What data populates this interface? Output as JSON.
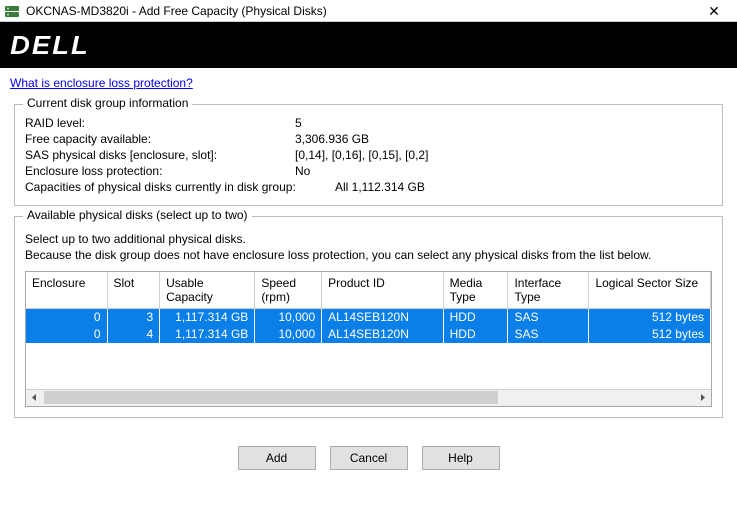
{
  "window": {
    "title": "OKCNAS-MD3820i - Add Free Capacity (Physical Disks)"
  },
  "brand": "DELL",
  "help_link": "What is enclosure loss protection?",
  "info_box": {
    "legend": "Current disk group information",
    "rows": [
      {
        "label": "RAID level:",
        "value": "5"
      },
      {
        "label": "Free capacity available:",
        "value": "3,306.936 GB"
      },
      {
        "label": "SAS physical disks [enclosure, slot]:",
        "value": "[0,14], [0,16], [0,15], [0,2]"
      },
      {
        "label": "Enclosure loss protection:",
        "value": "No"
      },
      {
        "label": "Capacities of physical disks currently in disk group:",
        "value": "All 1,112.314 GB"
      }
    ]
  },
  "available_box": {
    "legend": "Available physical disks (select up to two)",
    "instruction_1": "Select up to two additional physical disks.",
    "instruction_2": "Because the disk group does not have enclosure loss protection, you can select any physical disks from the list below.",
    "columns": [
      "Enclosure",
      "Slot",
      "Usable Capacity",
      "Speed (rpm)",
      "Product ID",
      "Media Type",
      "Interface Type",
      "Logical Sector Size"
    ],
    "rows": [
      {
        "enclosure": "0",
        "slot": "3",
        "capacity": "1,117.314 GB",
        "speed": "10,000",
        "product": "AL14SEB120N",
        "media": "HDD",
        "iface": "SAS",
        "sector": "512 bytes"
      },
      {
        "enclosure": "0",
        "slot": "4",
        "capacity": "1,117.314 GB",
        "speed": "10,000",
        "product": "AL14SEB120N",
        "media": "HDD",
        "iface": "SAS",
        "sector": "512 bytes"
      }
    ]
  },
  "buttons": {
    "add": "Add",
    "cancel": "Cancel",
    "help": "Help"
  }
}
